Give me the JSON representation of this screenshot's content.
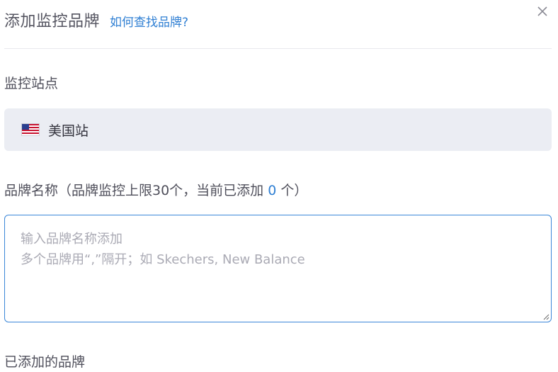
{
  "header": {
    "title": "添加监控品牌",
    "help_link": "如何查找品牌?"
  },
  "site": {
    "label": "监控站点",
    "selected": "美国站",
    "flag_icon": "us-flag-icon"
  },
  "brand": {
    "label_prefix": "品牌名称（品牌监控上限30个，当前已添加",
    "count": "0",
    "label_suffix": "个）",
    "placeholder_line1": "输入品牌名称添加",
    "placeholder_line2": "多个品牌用“,”隔开；如 Skechers, New Balance"
  },
  "added": {
    "label": "已添加的品牌"
  },
  "colors": {
    "accent": "#2f7fd3",
    "site_bg": "#ebedf3",
    "input_border": "#3a86d8"
  }
}
